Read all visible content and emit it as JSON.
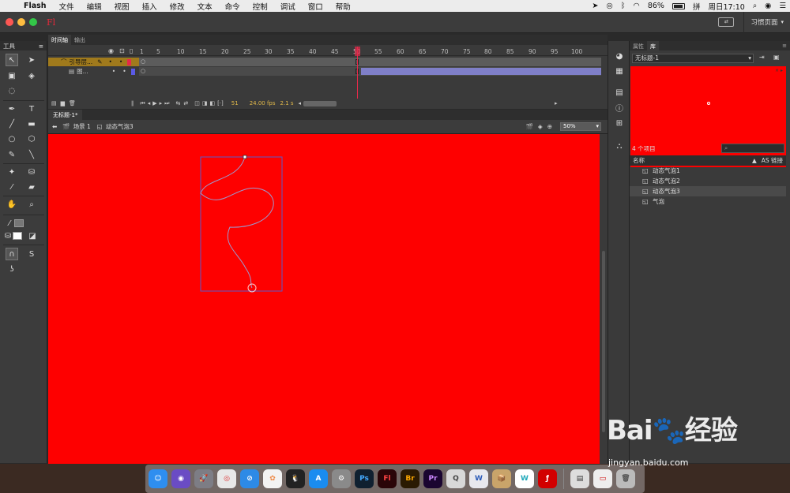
{
  "menubar": {
    "app": "Flash",
    "items": [
      "文件",
      "编辑",
      "视图",
      "插入",
      "修改",
      "文本",
      "命令",
      "控制",
      "调试",
      "窗口",
      "帮助"
    ],
    "battery": "86%",
    "clock": "周日17:10"
  },
  "appbar": {
    "logo": "Fl",
    "workspace": "习惯页面"
  },
  "tools": {
    "title": "工具"
  },
  "timeline": {
    "tabs": [
      "时间轴",
      "输出"
    ],
    "ruler": [
      "1",
      "5",
      "10",
      "15",
      "20",
      "25",
      "30",
      "35",
      "40",
      "45",
      "50",
      "55",
      "60",
      "65",
      "70",
      "75",
      "80",
      "85",
      "90",
      "95",
      "100"
    ],
    "layers": [
      {
        "name": "引导层..."
      },
      {
        "name": "图..."
      }
    ],
    "current_frame": "51",
    "fps": "24.00 fps",
    "time": "2.1 s"
  },
  "document": {
    "tab": "无标题-1*",
    "scene": "场景 1",
    "symbol": "动态气泡3",
    "zoom": "50%"
  },
  "stage": {
    "bg": "#fe0000"
  },
  "library": {
    "tabs": [
      "属性",
      "库"
    ],
    "doc": "无标题-1",
    "count": "4 个项目",
    "col_name": "名称",
    "col_as": "AS 链接",
    "items": [
      "动态气泡1",
      "动态气泡2",
      "动态气泡3",
      "气泡"
    ]
  },
  "watermark": {
    "logo": "Bai🐾经验",
    "url": "jingyan.baidu.com"
  }
}
